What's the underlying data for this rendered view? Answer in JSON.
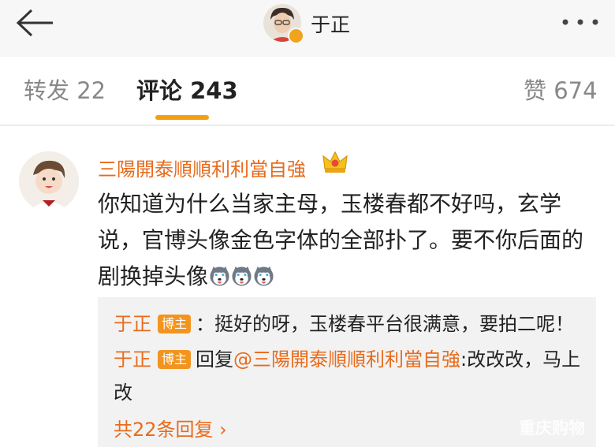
{
  "header": {
    "title": "于正",
    "back_icon": "arrow-left-icon",
    "more_icon": "more-dots-icon",
    "verified_color": "#f1a31c"
  },
  "tabs": [
    {
      "label": "转发 22"
    },
    {
      "label": "评论 243",
      "active": true
    },
    {
      "label": "赞 674"
    }
  ],
  "accent_color": "#f2a013",
  "comment": {
    "username": "三陽開泰順順利利當自強",
    "badge_icon": "crown-icon",
    "text": "你知道为什么当家主母，玉楼春都不好吗，玄学说，官博头像金色字体的全部扑了。要不你后面的剧换掉头像",
    "emoji_icon": "husky-emoji-icon",
    "replies": [
      {
        "name": "于正",
        "badge": "博主",
        "text": "：挺好的呀，玉楼春平台很满意，要拍二呢！"
      },
      {
        "name": "于正",
        "badge": "博主",
        "reply_prefix": "回复",
        "reply_to": "@三陽開泰順順利利當自強",
        "text": ":改改改，马上改"
      }
    ],
    "more_replies": "共22条回复 ›"
  },
  "watermark": "重庆购物"
}
